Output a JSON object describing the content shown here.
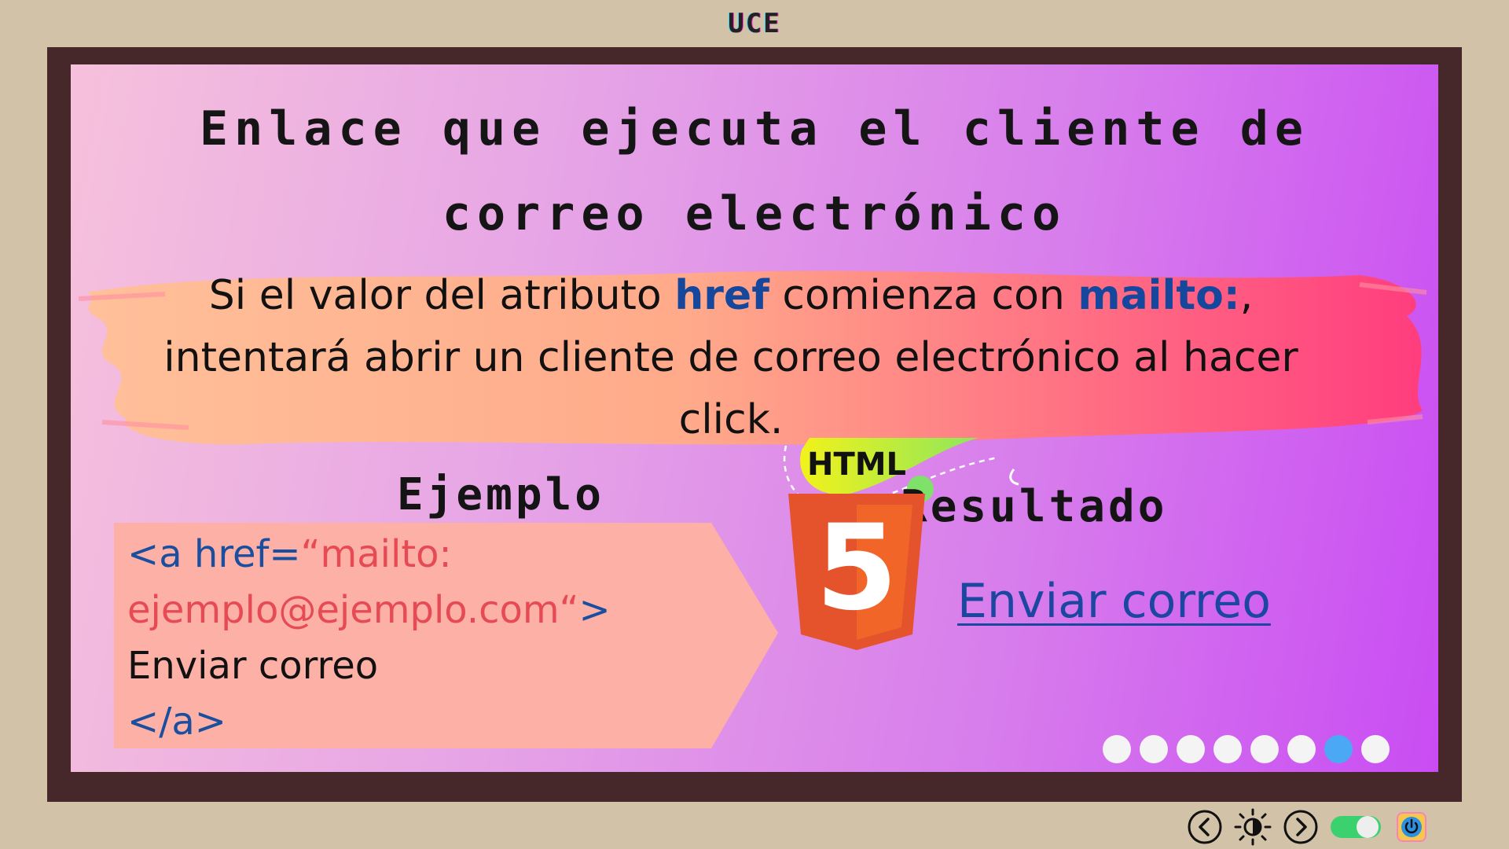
{
  "header": {
    "label": "UCE"
  },
  "slide": {
    "title": "Enlace que ejecuta el cliente de correo electrónico",
    "description": {
      "part1": "Si el valor del atributo ",
      "kw1": "href",
      "part2": " comienza con ",
      "kw2": "mailto:",
      "part3": ", intentará abrir un cliente de correo electrónico al hacer click."
    },
    "example_heading": "Ejemplo",
    "result_heading": "Resultado",
    "code": {
      "open_tag": "<a href=",
      "attr_value_1": "“mailto:",
      "attr_value_2": "ejemplo@ejemplo.com“",
      "close_bracket": ">",
      "link_text": "Enviar correo",
      "close_tag": "</a>"
    },
    "logo_text": "HTML",
    "logo_number": "5",
    "result_link": "Enviar correo"
  },
  "pagination": {
    "total": 8,
    "active_index": 6
  },
  "controls": [
    "prev-icon",
    "brightness-icon",
    "next-icon",
    "toggle-switch",
    "power-icon"
  ],
  "colors": {
    "background": "#d2c2a8",
    "frame": "#46282b",
    "keyword": "#15479c",
    "code_string": "#e64b55",
    "link": "#1c47a0",
    "active_dot": "#4aa8f4"
  }
}
